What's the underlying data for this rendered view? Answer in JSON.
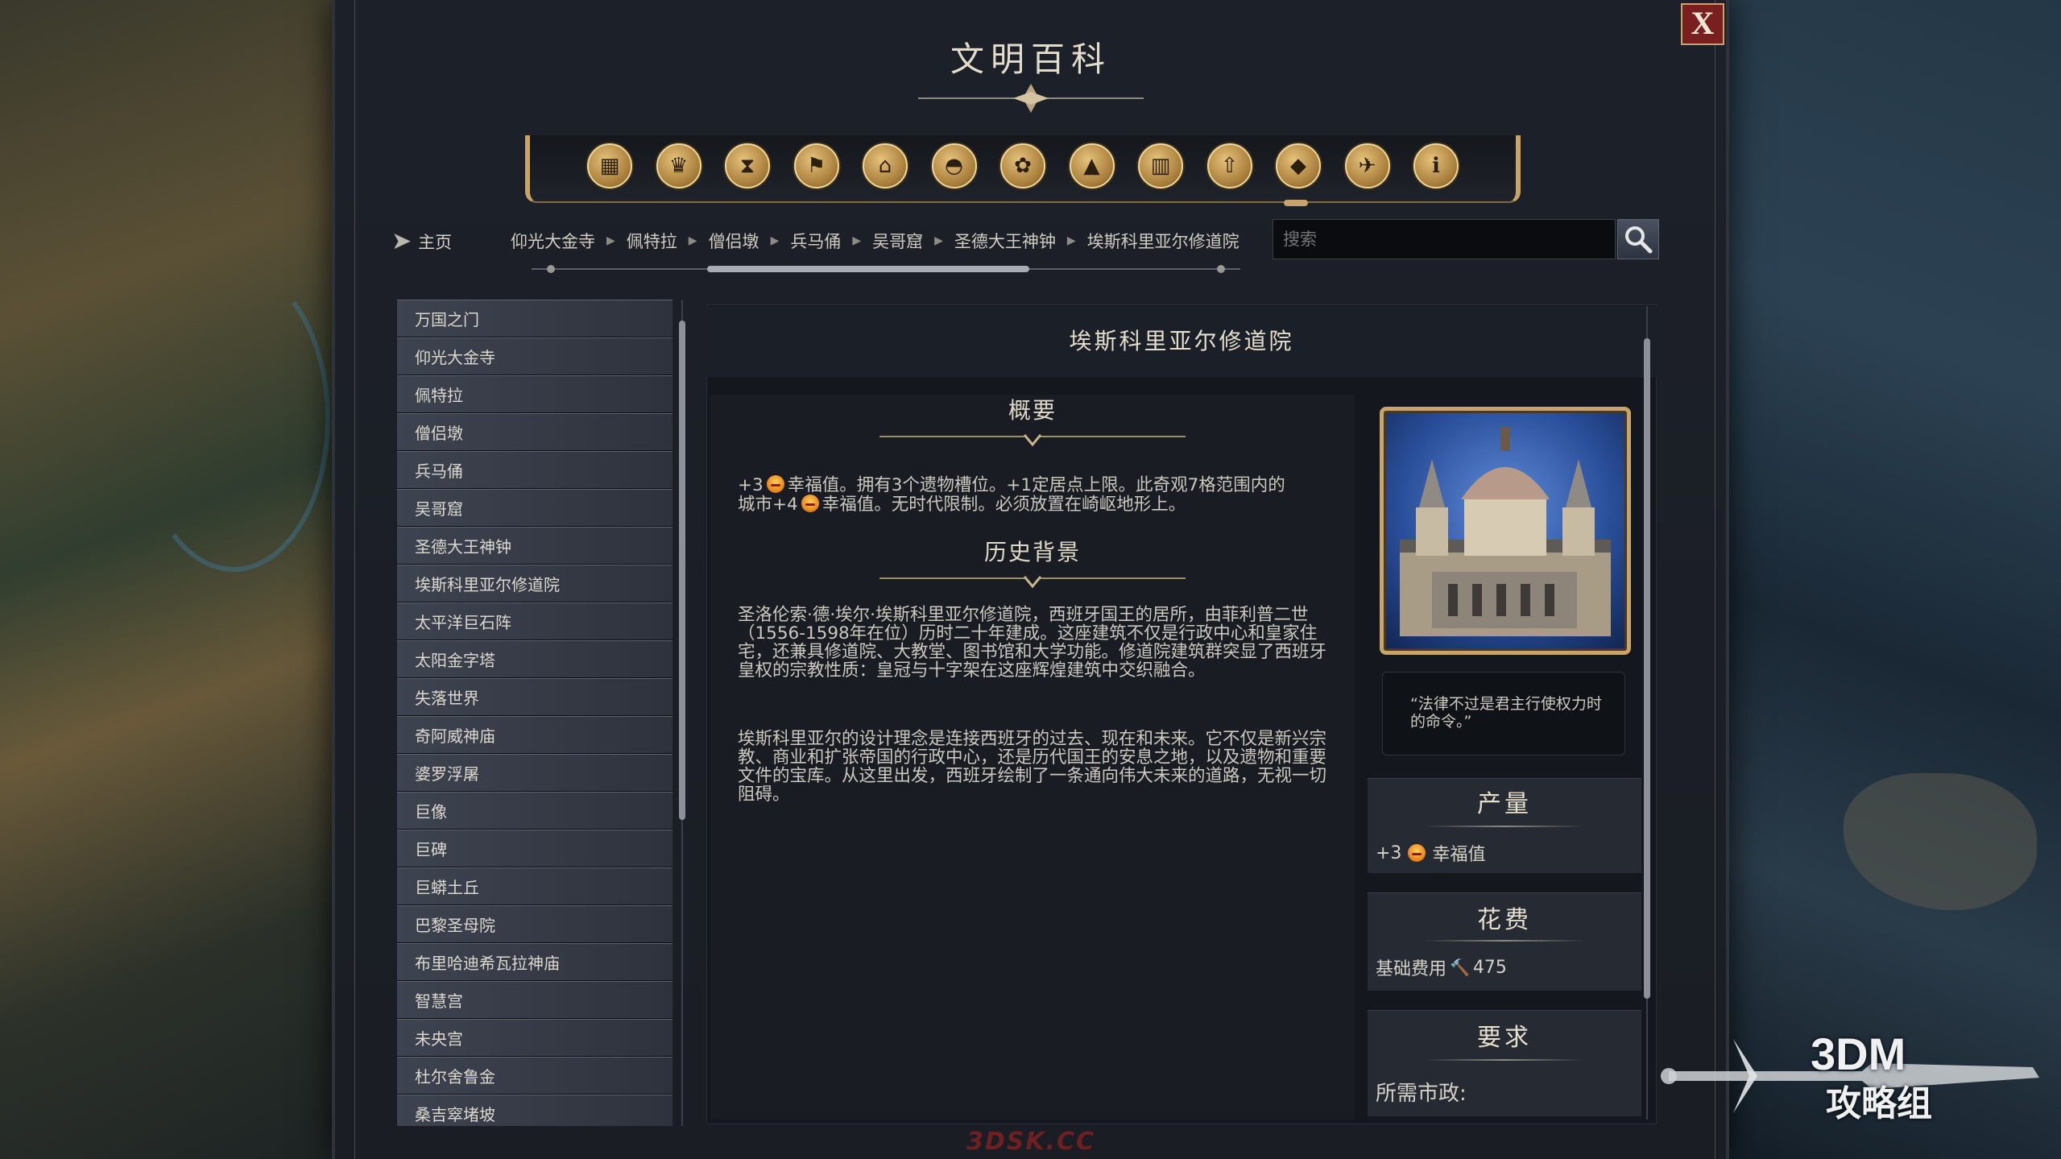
{
  "window": {
    "title": "文明百科",
    "close_label": "X"
  },
  "categories": [
    {
      "icon": "crates-icon"
    },
    {
      "icon": "goblet-icon"
    },
    {
      "icon": "hourglass-icon"
    },
    {
      "icon": "flag-icon"
    },
    {
      "icon": "temple-icon"
    },
    {
      "icon": "dome-icon"
    },
    {
      "icon": "flower-icon"
    },
    {
      "icon": "mountain-icon"
    },
    {
      "icon": "building-icon"
    },
    {
      "icon": "up-arrow-icon"
    },
    {
      "icon": "gem-icon"
    },
    {
      "icon": "bird-icon"
    },
    {
      "icon": "info-icon"
    }
  ],
  "nav": {
    "home_label": "主页",
    "breadcrumbs": [
      "仰光大金寺",
      "佩特拉",
      "僧侣墩",
      "兵马俑",
      "吴哥窟",
      "圣德大王神钟",
      "埃斯科里亚尔修道院"
    ],
    "search_placeholder": "搜索"
  },
  "sidebar": {
    "items": [
      "万国之门",
      "仰光大金寺",
      "佩特拉",
      "僧侣墩",
      "兵马俑",
      "吴哥窟",
      "圣德大王神钟",
      "埃斯科里亚尔修道院",
      "太平洋巨石阵",
      "太阳金字塔",
      "失落世界",
      "奇阿威神庙",
      "婆罗浮屠",
      "巨像",
      "巨碑",
      "巨蟒土丘",
      "巴黎圣母院",
      "布里哈迪希瓦拉神庙",
      "智慧宫",
      "未央宫",
      "杜尔舍鲁金",
      "桑吉窣堵坡"
    ]
  },
  "article": {
    "title": "埃斯科里亚尔修道院",
    "overview_title": "概要",
    "overview_line1_pre": "+3",
    "overview_line1_post": "幸福值。拥有3个遗物槽位。+1定居点上限。此奇观7格范围内的",
    "overview_line2_pre": "城市+4",
    "overview_line2_post": "幸福值。无时代限制。必须放置在崎岖地形上。",
    "history_title": "历史背景",
    "history_p1": "圣洛伦索·德·埃尔·埃斯科里亚尔修道院，西班牙国王的居所，由菲利普二世（1556-1598年在位）历时二十年建成。这座建筑不仅是行政中心和皇家住宅，还兼具修道院、大教堂、图书馆和大学功能。修道院建筑群突显了西班牙皇权的宗教性质：皇冠与十字架在这座辉煌建筑中交织融合。",
    "history_p2": "埃斯科里亚尔的设计理念是连接西班牙的过去、现在和未来。它不仅是新兴宗教、商业和扩张帝国的行政中心，还是历代国王的安息之地，以及遗物和重要文件的宝库。从这里出发，西班牙绘制了一条通向伟大未来的道路，无视一切阻碍。",
    "quote": "“法律不过是君主行使权力时的命令。”"
  },
  "production": {
    "title": "产量",
    "value": "+3",
    "label": "幸福值"
  },
  "cost": {
    "title": "花费",
    "label": "基础费用",
    "value": "475"
  },
  "requirements": {
    "title": "要求",
    "civic_label": "所需市政:"
  },
  "watermark": {
    "line1": "3DM",
    "line2": "攻略组",
    "bottom": "3DSK.CC"
  },
  "colors": {
    "gold": "#c9a468",
    "close_red": "#7a1f1f",
    "panel": "#1a1d24"
  }
}
